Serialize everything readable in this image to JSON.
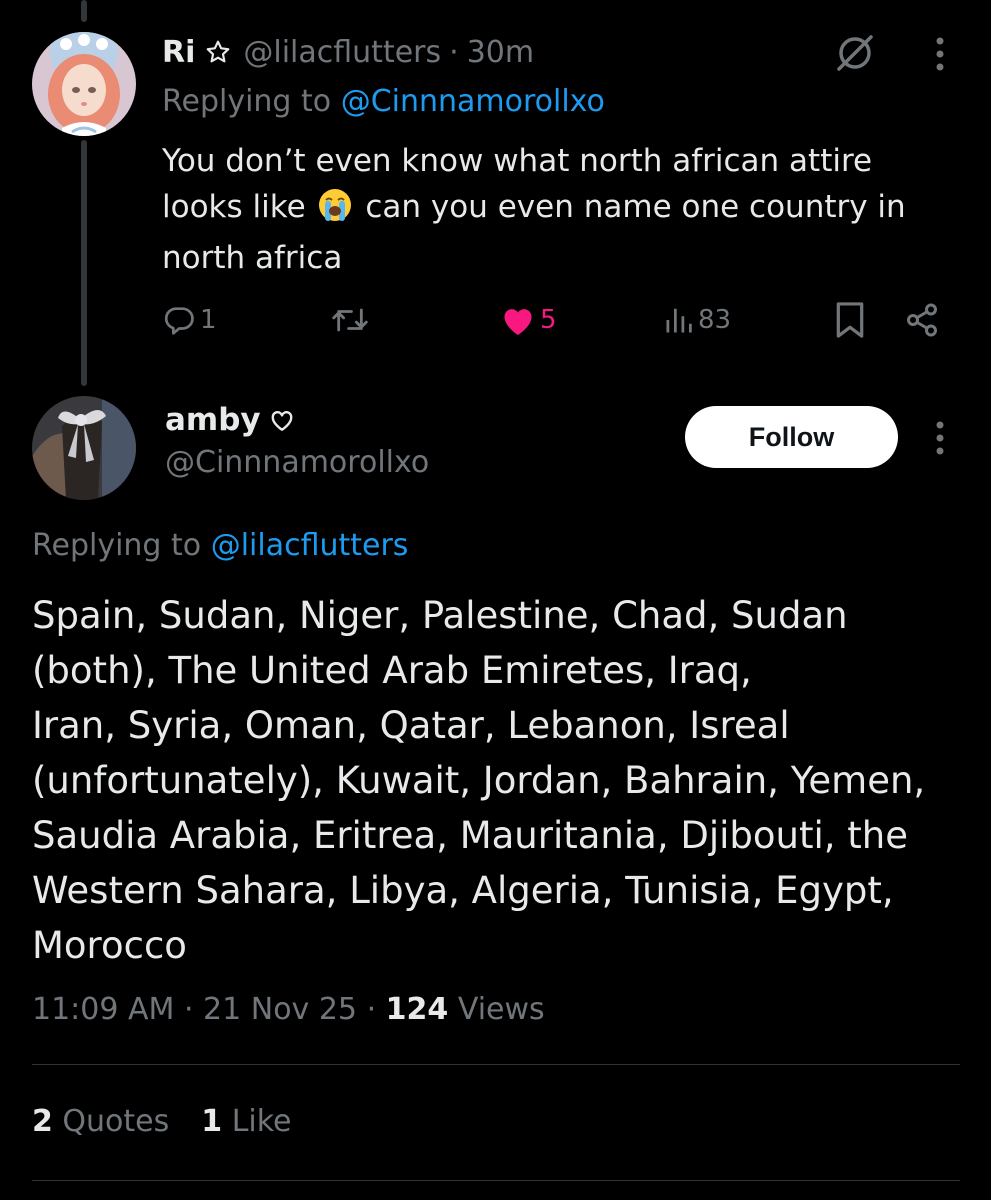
{
  "reply_tweet": {
    "display_name": "Ri",
    "handle": "@lilacflutters",
    "separator": "·",
    "time": "30m",
    "replying_prefix": "Replying to",
    "replying_to": "@Cinnnamorollxo",
    "text_lines": [
      {
        "before": "You don’t even know what north african attire",
        "emoji": "",
        "after": ""
      },
      {
        "before": "looks like",
        "emoji": "loudly-crying-face",
        "after": "can you even name one country in"
      },
      {
        "before": "north africa",
        "emoji": "",
        "after": ""
      }
    ],
    "actions": {
      "reply_count": "1",
      "retweet_count": "",
      "like_count": "5",
      "view_count": "83"
    },
    "icons": [
      "grok-icon",
      "more-icon",
      "reply-icon",
      "retweet-icon",
      "heart-filled-icon",
      "views-icon",
      "bookmark-icon",
      "share-icon"
    ]
  },
  "main_tweet": {
    "display_name": "amby",
    "name_icon": "heart-outline-icon",
    "handle": "@Cinnnamorollxo",
    "follow_label": "Follow",
    "replying_prefix": "Replying to",
    "replying_to": "@lilacflutters",
    "text_lines": [
      "Spain, Sudan, Niger, Palestine, Chad, Sudan",
      "(both), The United Arab Emiretes, Iraq,",
      "Iran, Syria, Oman, Qatar, Lebanon, Isreal",
      "(unfortunately), Kuwait, Jordan, Bahrain, Yemen,",
      "Saudia Arabia, Eritrea, Mauritania, Djibouti, the",
      "Western Sahara, Libya, Algeria, Tunisia, Egypt,",
      "Morocco"
    ],
    "time": "11:09 AM",
    "date": "21 Nov 25",
    "separator": "·",
    "views_count": "124",
    "views_label": "Views",
    "quotes_count": "2",
    "quotes_label": "Quotes",
    "likes_count": "1",
    "likes_label": "Like"
  },
  "colors": {
    "background": "#000000",
    "text": "#e7e9ea",
    "secondary": "#71767b",
    "link": "#1d9bf0",
    "like": "#f91880",
    "divider": "#2f3336"
  }
}
